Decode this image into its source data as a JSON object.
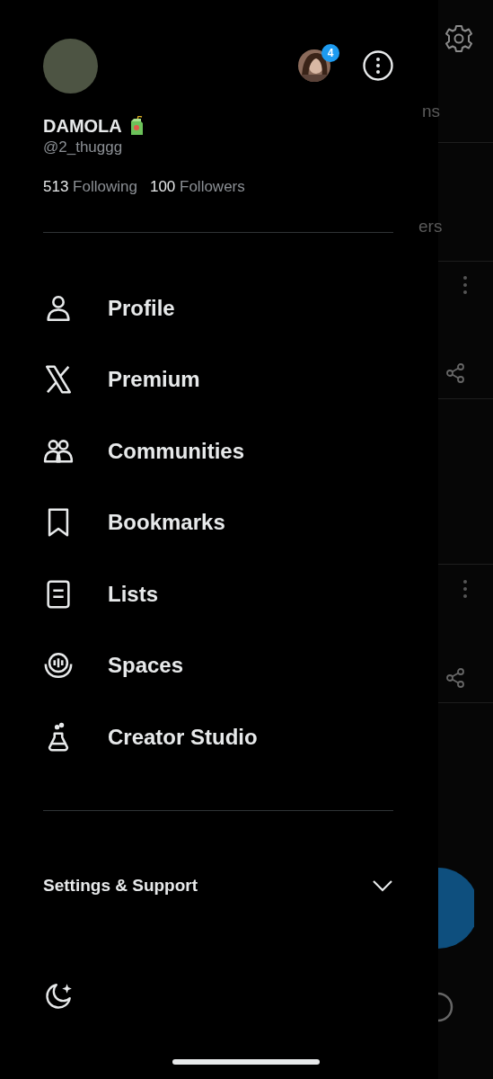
{
  "profile": {
    "name": "DAMOLA",
    "handle": "@2_thuggg",
    "following_count": "513",
    "following_label": "Following",
    "followers_count": "100",
    "followers_label": "Followers",
    "account_badge": "4"
  },
  "menu": [
    {
      "kind": "person",
      "label": "Profile"
    },
    {
      "kind": "x",
      "label": "Premium"
    },
    {
      "kind": "people",
      "label": "Communities"
    },
    {
      "kind": "bookmark",
      "label": "Bookmarks"
    },
    {
      "kind": "list",
      "label": "Lists"
    },
    {
      "kind": "spaces",
      "label": "Spaces"
    },
    {
      "kind": "flask",
      "label": "Creator Studio"
    }
  ],
  "settings_support": {
    "label": "Settings & Support",
    "expanded": false
  },
  "background": {
    "tab_1": "ns",
    "tab_2": "ers"
  }
}
